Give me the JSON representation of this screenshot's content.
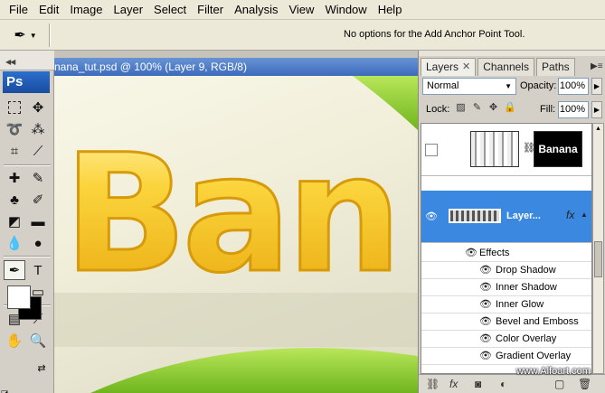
{
  "menu": [
    "File",
    "Edit",
    "Image",
    "Layer",
    "Select",
    "Filter",
    "Analysis",
    "View",
    "Window",
    "Help"
  ],
  "options_bar": {
    "message": "No options for the Add Anchor Point Tool."
  },
  "toolbox": {
    "logo": "Ps"
  },
  "document": {
    "title": "nana_tut.psd @ 100% (Layer 9, RGB/8)",
    "canvas_text": "Ban"
  },
  "panel": {
    "tabs": [
      "Layers",
      "Channels",
      "Paths"
    ],
    "blend_mode": "Normal",
    "opacity_label": "Opacity:",
    "opacity_value": "100%",
    "lock_label": "Lock:",
    "fill_label": "Fill:",
    "fill_value": "100%",
    "layers": [
      {
        "mask_text": "Banana"
      },
      {
        "name": "Layer...",
        "fx": "fx"
      }
    ],
    "effects_header": "Effects",
    "effects": [
      "Drop Shadow",
      "Inner Shadow",
      "Inner Glow",
      "Bevel and Emboss",
      "Color Overlay",
      "Gradient Overlay"
    ]
  },
  "watermark": "www.Alfoart.com",
  "colors": {
    "accent": "#3b88e0",
    "title_bar": "#3d6bbc",
    "banana_yellow": "#f5c518"
  }
}
